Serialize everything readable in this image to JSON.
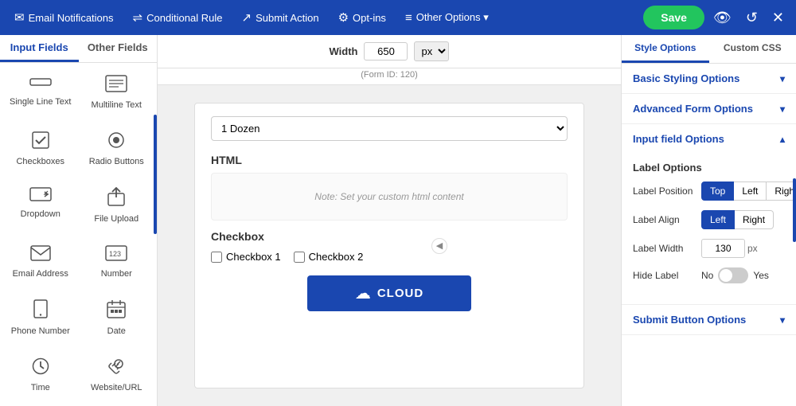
{
  "nav": {
    "items": [
      {
        "id": "email-notifications",
        "icon": "✉",
        "label": "Email Notifications"
      },
      {
        "id": "conditional-rule",
        "icon": "⇌",
        "label": "Conditional Rule"
      },
      {
        "id": "submit-action",
        "icon": "↗",
        "label": "Submit Action"
      },
      {
        "id": "opt-ins",
        "icon": "⚙",
        "label": "Opt-ins"
      },
      {
        "id": "other-options",
        "icon": "≡",
        "label": "Other Options ▾"
      }
    ],
    "save_label": "Save"
  },
  "sidebar": {
    "tabs": [
      {
        "id": "input-fields",
        "label": "Input Fields"
      },
      {
        "id": "other-fields",
        "label": "Other Fields"
      }
    ],
    "items": [
      {
        "id": "single-line-text",
        "icon": "▬",
        "label": "Single Line Text"
      },
      {
        "id": "multiline-text",
        "icon": "☰",
        "label": "Multiline Text"
      },
      {
        "id": "checkboxes",
        "icon": "☑",
        "label": "Checkboxes"
      },
      {
        "id": "radio-buttons",
        "icon": "◎",
        "label": "Radio Buttons"
      },
      {
        "id": "dropdown",
        "icon": "⌄",
        "label": "Dropdown"
      },
      {
        "id": "file-upload",
        "icon": "↑",
        "label": "File Upload"
      },
      {
        "id": "email-address",
        "icon": "✉",
        "label": "Email Address"
      },
      {
        "id": "number",
        "icon": "123",
        "label": "Number"
      },
      {
        "id": "phone-number",
        "icon": "☎",
        "label": "Phone Number"
      },
      {
        "id": "date",
        "icon": "▦",
        "label": "Date"
      },
      {
        "id": "time",
        "icon": "⏱",
        "label": "Time"
      },
      {
        "id": "website-url",
        "icon": "🔗",
        "label": "Website/URL"
      }
    ]
  },
  "canvas": {
    "width_label": "Width",
    "width_value": "650",
    "width_unit": "px",
    "form_id": "(Form ID: 120)",
    "dropdown_value": "1 Dozen",
    "html_section_title": "HTML",
    "html_note": "Note: Set your custom html content",
    "checkbox_section_title": "Checkbox",
    "checkbox_items": [
      "Checkbox 1",
      "Checkbox 2"
    ],
    "submit_btn_label": "CLOUD",
    "collapse_icon": "◀"
  },
  "right_panel": {
    "tabs": [
      {
        "id": "style-options",
        "label": "Style Options"
      },
      {
        "id": "custom-css",
        "label": "Custom CSS"
      }
    ],
    "sections": [
      {
        "id": "basic-styling",
        "label": "Basic Styling Options",
        "open": false
      },
      {
        "id": "advanced-form",
        "label": "Advanced Form Options",
        "open": false
      },
      {
        "id": "input-field-options",
        "label": "Input field Options",
        "open": true
      }
    ],
    "label_options": {
      "title": "Label Options",
      "position_label": "Label Position",
      "position_buttons": [
        "Top",
        "Left",
        "Right"
      ],
      "position_active": "Top",
      "align_label": "Label Align",
      "align_buttons": [
        "Left",
        "Right"
      ],
      "align_active": "Left",
      "width_label": "Label Width",
      "width_value": "130",
      "width_unit": "px",
      "hide_label": "Hide Label",
      "hide_no": "No",
      "hide_yes": "Yes",
      "hide_checked": false
    },
    "submit_button": {
      "label": "Submit Button Options"
    }
  }
}
